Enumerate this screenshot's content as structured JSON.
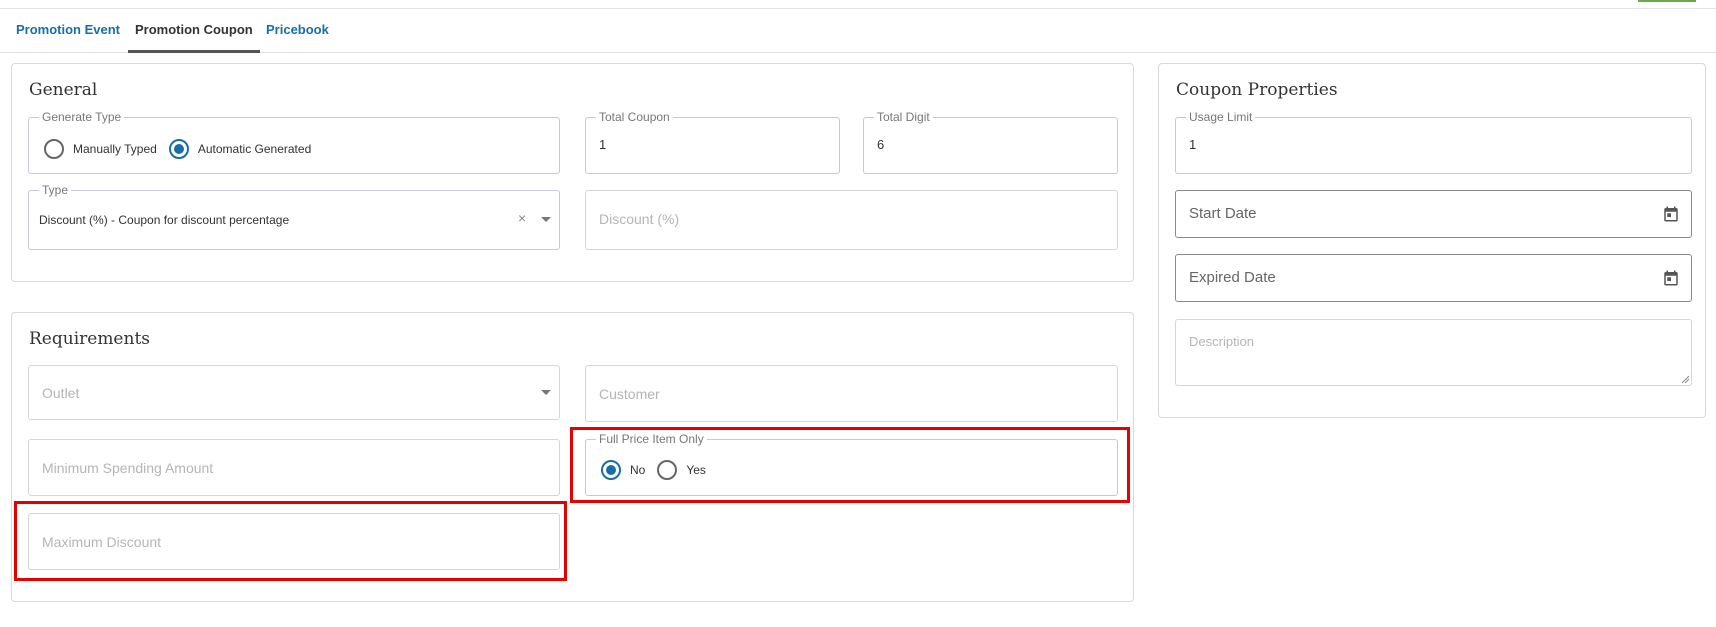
{
  "tabs": [
    {
      "label": "Promotion Event"
    },
    {
      "label": "Promotion Coupon"
    },
    {
      "label": "Pricebook"
    }
  ],
  "active_tab": "Promotion Coupon",
  "general": {
    "title": "General",
    "generate_type": {
      "legend": "Generate Type",
      "options": [
        "Manually Typed",
        "Automatic Generated"
      ],
      "selected": "Automatic Generated"
    },
    "total_coupon": {
      "legend": "Total Coupon",
      "value": "1"
    },
    "total_digit": {
      "legend": "Total Digit",
      "value": "6"
    },
    "type": {
      "legend": "Type",
      "value": "Discount (%) - Coupon for discount percentage",
      "clear": "×"
    },
    "discount": {
      "placeholder": "Discount (%)"
    }
  },
  "requirements": {
    "title": "Requirements",
    "outlet": {
      "placeholder": "Outlet"
    },
    "customer": {
      "placeholder": "Customer"
    },
    "min_spending": {
      "placeholder": "Minimum Spending Amount"
    },
    "full_price_item_only": {
      "legend": "Full Price Item Only",
      "options": [
        "No",
        "Yes"
      ],
      "selected": "No"
    },
    "max_discount": {
      "placeholder": "Maximum Discount"
    }
  },
  "coupon_properties": {
    "title": "Coupon Properties",
    "usage_limit": {
      "legend": "Usage Limit",
      "value": "1"
    },
    "start_date": {
      "placeholder": "Start Date"
    },
    "expired_date": {
      "placeholder": "Expired Date"
    },
    "description": {
      "placeholder": "Description"
    }
  },
  "colors": {
    "accent": "#1a6ea8",
    "highlight": "#e60000"
  },
  "icons": [
    "calendar-icon",
    "chevron-down-icon",
    "clear-icon"
  ]
}
